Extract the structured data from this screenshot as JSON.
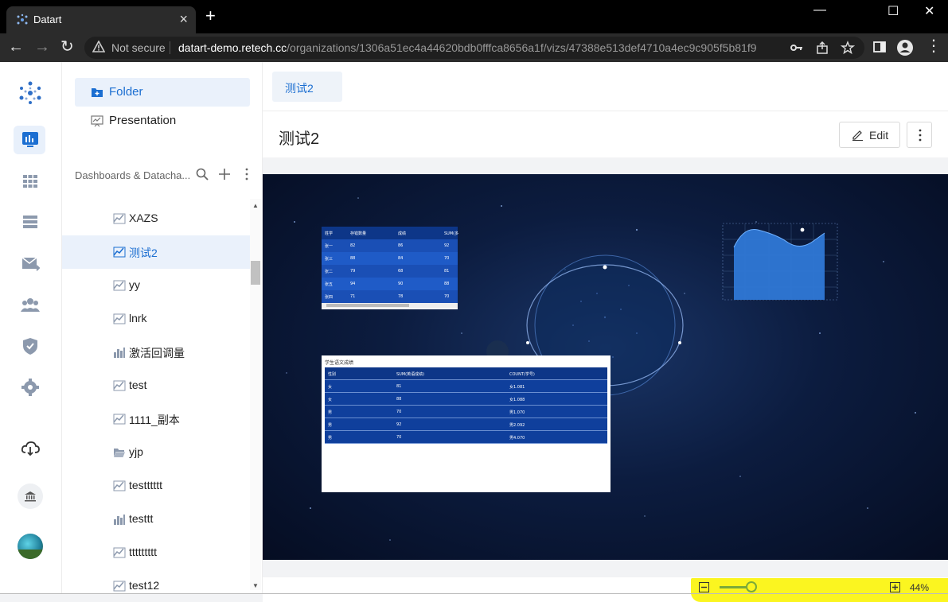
{
  "browser": {
    "tab_title": "Datart",
    "security_label": "Not secure",
    "url_host": "datart-demo.retech.cc",
    "url_path": "/organizations/1306a51ec4a44620bdb0fffca8656a1f/vizs/47388e513def4710a4ec9c905f5b81f9"
  },
  "rail": {
    "items": [
      "viz-icon",
      "grid-icon",
      "list-icon",
      "schedule-icon",
      "members-icon",
      "permission-icon",
      "settings-icon",
      "download-icon",
      "organization-icon",
      "avatar"
    ]
  },
  "sidebar": {
    "modes": [
      {
        "label": "Folder",
        "active": true
      },
      {
        "label": "Presentation",
        "active": false
      }
    ],
    "header_label": "Dashboards & Datacha...",
    "items": [
      {
        "label": "XAZS",
        "icon": "line-chart-icon",
        "active": false
      },
      {
        "label": "测试2",
        "icon": "line-chart-icon",
        "active": true
      },
      {
        "label": "yy",
        "icon": "line-chart-icon",
        "active": false
      },
      {
        "label": "lnrk",
        "icon": "line-chart-icon",
        "active": false
      },
      {
        "label": "激活回调量",
        "icon": "bar-chart-icon",
        "active": false
      },
      {
        "label": "test",
        "icon": "line-chart-icon",
        "active": false
      },
      {
        "label": "1111_副本",
        "icon": "line-chart-icon",
        "active": false
      },
      {
        "label": "yjp",
        "icon": "folder-open-icon",
        "active": false
      },
      {
        "label": "testttttt",
        "icon": "line-chart-icon",
        "active": false
      },
      {
        "label": "testtt",
        "icon": "bar-chart-icon",
        "active": false
      },
      {
        "label": "ttttttttt",
        "icon": "line-chart-icon",
        "active": false
      },
      {
        "label": "test12",
        "icon": "line-chart-icon",
        "active": false
      }
    ]
  },
  "main": {
    "tab_label": "测试2",
    "title": "测试2",
    "edit_label": "Edit"
  },
  "widgets": {
    "table1": {
      "headers": [
        "姓学",
        "存错数量",
        "成绩",
        "SUM(多"
      ],
      "rows": [
        [
          "张一",
          "82",
          "86",
          "92"
        ],
        [
          "张三",
          "88",
          "84",
          "70"
        ],
        [
          "张二",
          "79",
          "68",
          "81"
        ],
        [
          "张五",
          "94",
          "90",
          "88"
        ],
        [
          "张四",
          "71",
          "78",
          "70"
        ]
      ]
    },
    "table2": {
      "caption": "学生语文成绩",
      "headers": [
        "性别",
        "SUM(英语成绩)",
        "COUNT(学号)"
      ],
      "rows": [
        [
          "女",
          "81",
          "女1.081"
        ],
        [
          "女",
          "88",
          "女1.088"
        ],
        [
          "男",
          "70",
          "男1.070"
        ],
        [
          "男",
          "92",
          "男2.092"
        ],
        [
          "男",
          "70",
          "男4.070"
        ]
      ]
    }
  },
  "zoom": {
    "value_label": "44%",
    "level": 0.44
  },
  "colors": {
    "accent": "#1b6ed1",
    "highlight": "#fbf520",
    "table_blue": "#0f3f9c",
    "canvas_bg": "#0c1c3f"
  }
}
